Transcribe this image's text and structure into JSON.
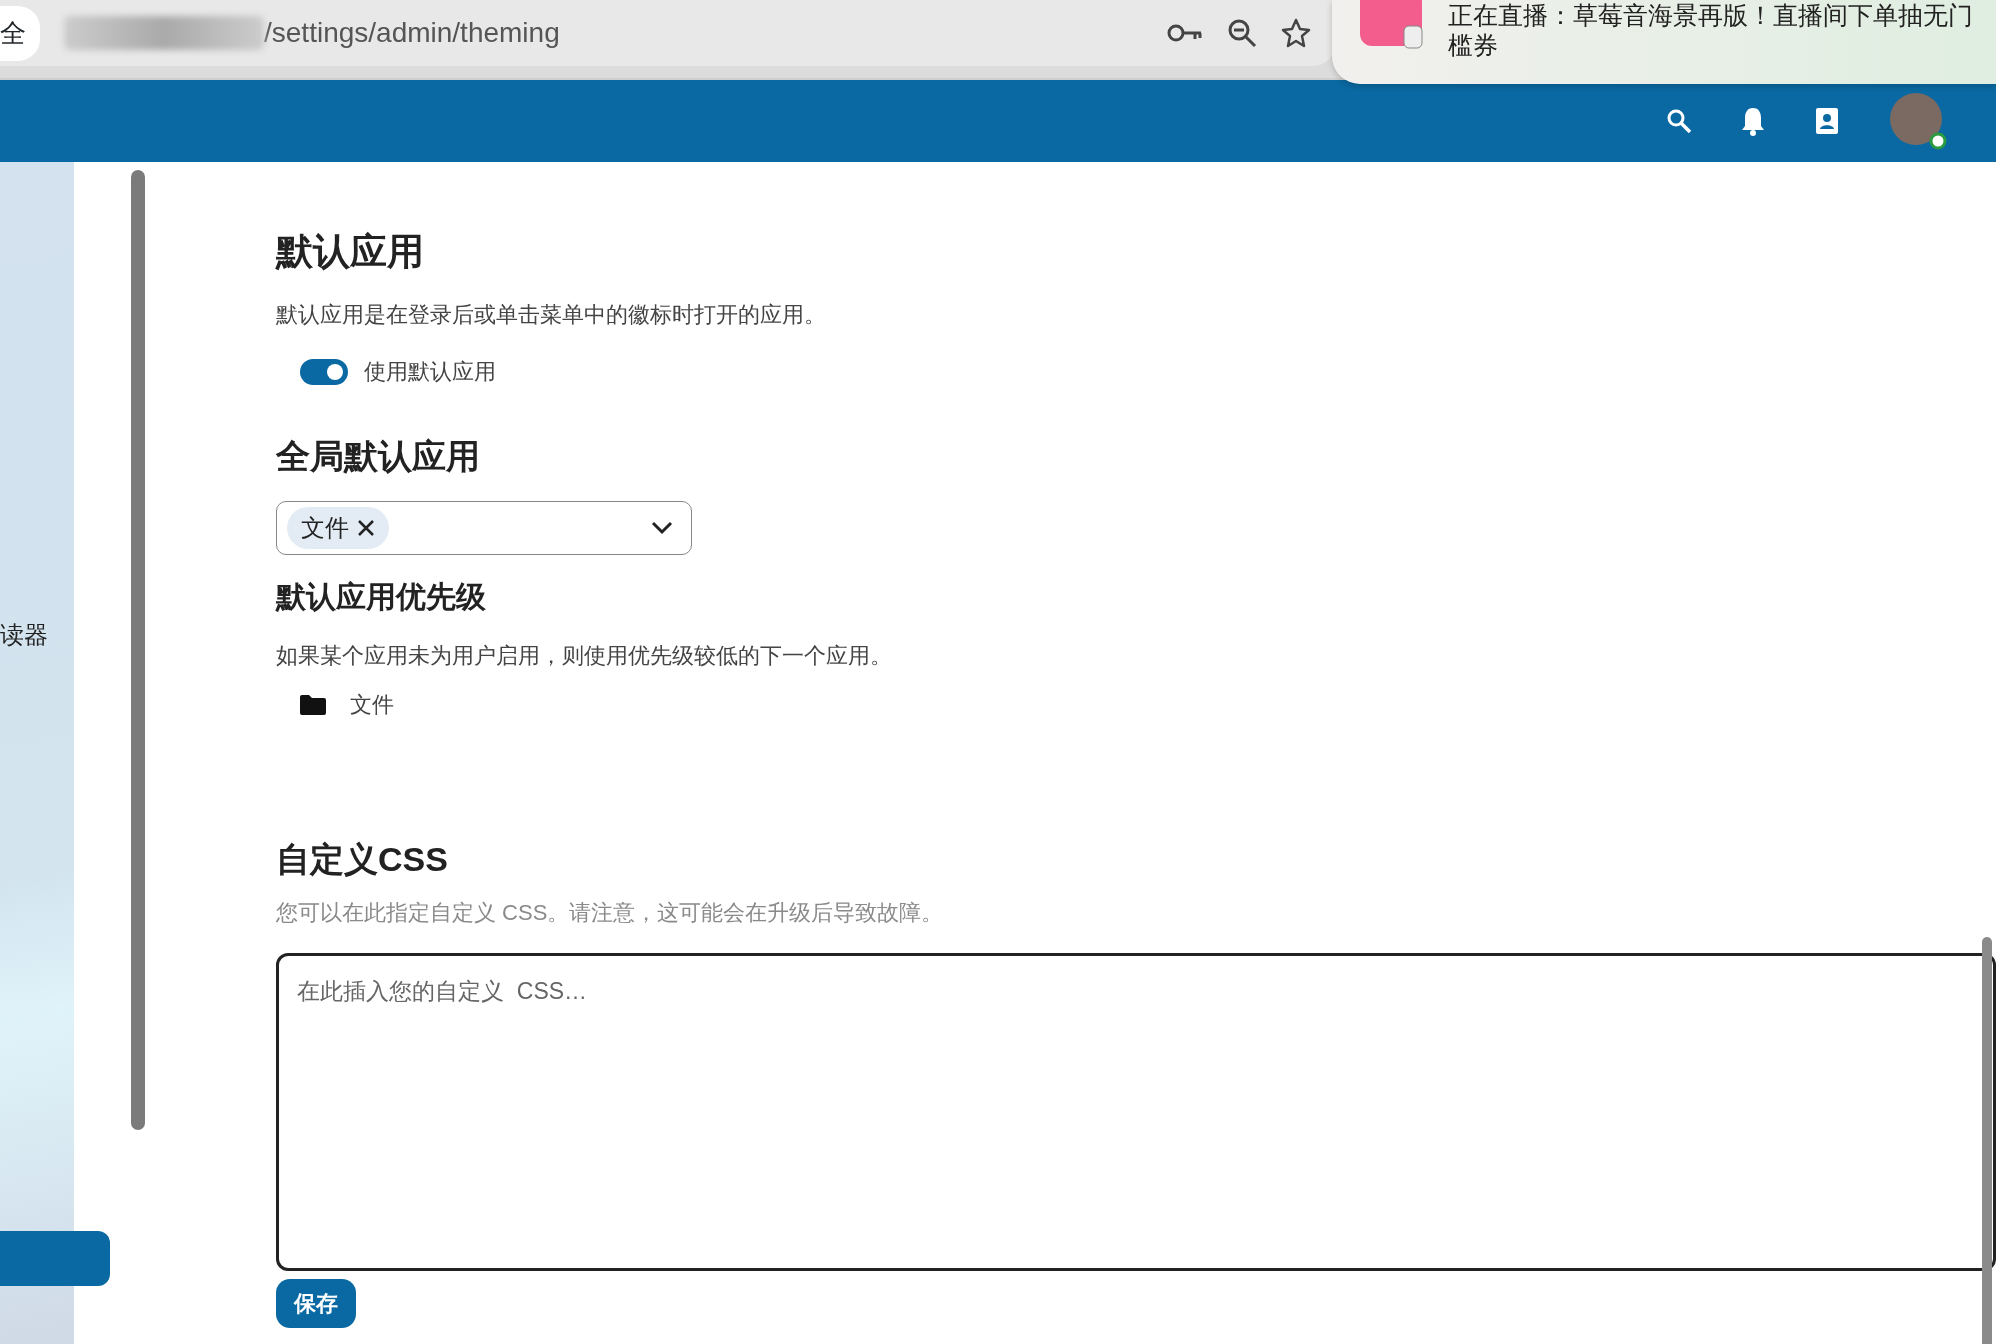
{
  "browser": {
    "security_label": "全",
    "url": "/settings/admin/theming"
  },
  "notification": {
    "lines": [
      "正在直播：草莓音海景再版！直播间下单抽无门",
      "槛券"
    ]
  },
  "sidebar": {
    "items": [
      {
        "label": "读器"
      }
    ]
  },
  "default_app": {
    "title": "默认应用",
    "description": "默认应用是在登录后或单击菜单中的徽标时打开的应用。",
    "toggle": {
      "label": "使用默认应用",
      "on": true
    }
  },
  "global_default": {
    "title": "全局默认应用",
    "tags": [
      {
        "label": "文件"
      }
    ]
  },
  "priority": {
    "title": "默认应用优先级",
    "description": "如果某个应用未为用户启用，则使用优先级较低的下一个应用。",
    "items": [
      {
        "label": "文件"
      }
    ]
  },
  "custom_css": {
    "title": "自定义CSS",
    "description": "您可以在此指定自定义 CSS。请注意，这可能会在升级后导致故障。",
    "placeholder": "在此插入您的自定义  CSS…",
    "button": "保存"
  }
}
